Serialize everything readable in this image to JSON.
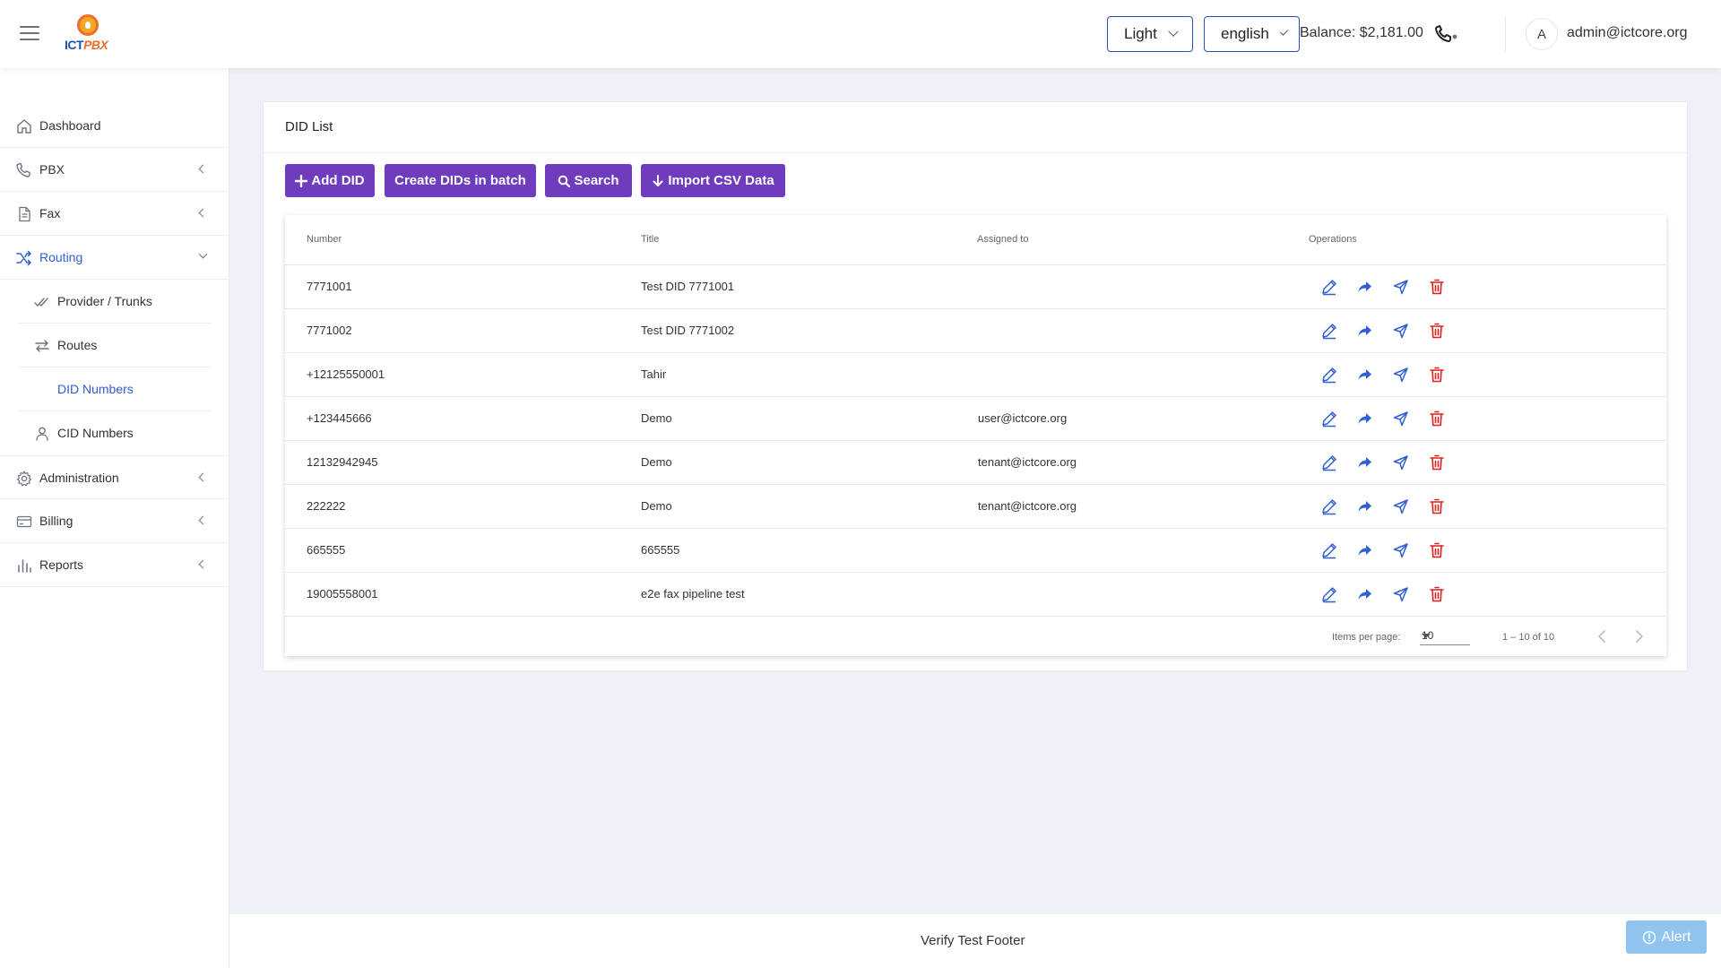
{
  "header": {
    "logo_text_a": "ICT",
    "logo_text_b": "PBX",
    "theme": "Light",
    "language": "english",
    "balance": "Balance: $2,181.00",
    "avatar_initial": "A",
    "user_email": "admin@ictcore.org"
  },
  "sidebar": {
    "items": [
      {
        "label": "Dashboard",
        "icon": "home-icon"
      },
      {
        "label": "PBX",
        "icon": "phone-icon"
      },
      {
        "label": "Fax",
        "icon": "document-icon"
      },
      {
        "label": "Routing",
        "icon": "shuffle-icon",
        "active": true
      },
      {
        "label": "Administration",
        "icon": "gear-icon"
      },
      {
        "label": "Billing",
        "icon": "card-icon"
      },
      {
        "label": "Reports",
        "icon": "bar-chart-icon"
      }
    ],
    "routing_sub": [
      {
        "label": "Provider / Trunks",
        "icon": "double-check-icon"
      },
      {
        "label": "Routes",
        "icon": "swap-icon"
      },
      {
        "label": "DID Numbers",
        "active": true
      },
      {
        "label": "CID Numbers",
        "icon": "person-icon"
      }
    ]
  },
  "main": {
    "title": "DID List",
    "buttons": {
      "add": "Add DID",
      "batch": "Create DIDs in batch",
      "search": "Search",
      "import": "Import CSV Data"
    },
    "table": {
      "headers": [
        "Number",
        "Title",
        "Assigned to",
        "Operations"
      ],
      "rows": [
        {
          "number": "7771001",
          "title": "Test DID 7771001",
          "assigned": ""
        },
        {
          "number": "7771002",
          "title": "Test DID 7771002",
          "assigned": ""
        },
        {
          "number": "+12125550001",
          "title": "Tahir",
          "assigned": ""
        },
        {
          "number": "+123445666",
          "title": "Demo",
          "assigned": "user@ictcore.org"
        },
        {
          "number": "12132942945",
          "title": "Demo",
          "assigned": "tenant@ictcore.org"
        },
        {
          "number": "222222",
          "title": "Demo",
          "assigned": "tenant@ictcore.org"
        },
        {
          "number": "665555",
          "title": "665555",
          "assigned": ""
        },
        {
          "number": "19005558001",
          "title": "e2e fax pipeline test",
          "assigned": ""
        }
      ]
    },
    "paginator": {
      "label": "Items per page:",
      "per_page": "10",
      "range": "1 – 10 of 10"
    }
  },
  "footer": {
    "text": "Verify Test Footer",
    "alert": "Alert"
  },
  "colors": {
    "primary_button": "#6f3bbf",
    "active_link": "#2f5fd3",
    "edit_icon": "#2f5fd3",
    "delete_icon": "#e11d1d",
    "alert_button": "#90c4ef"
  }
}
